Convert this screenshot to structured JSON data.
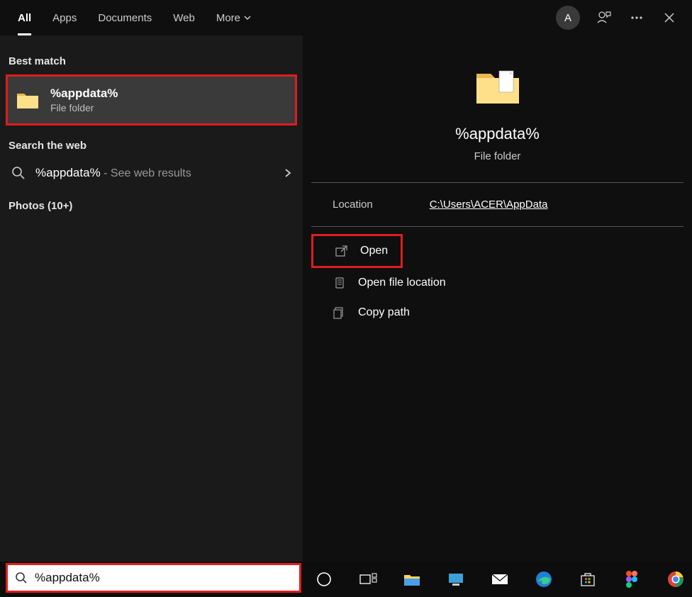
{
  "tabs": {
    "all": "All",
    "apps": "Apps",
    "documents": "Documents",
    "web": "Web",
    "more": "More"
  },
  "user_initial": "A",
  "left": {
    "best_match_label": "Best match",
    "best_result": {
      "title": "%appdata%",
      "sub": "File folder"
    },
    "search_web_label": "Search the web",
    "web_result": {
      "title": "%appdata%",
      "sub": " - See web results"
    },
    "photos_label": "Photos (10+)"
  },
  "detail": {
    "title": "%appdata%",
    "sub": "File folder",
    "location_label": "Location",
    "location_path": "C:\\Users\\ACER\\AppData",
    "actions": {
      "open": "Open",
      "open_file_location": "Open file location",
      "copy_path": "Copy path"
    }
  },
  "search_value": "%appdata%"
}
